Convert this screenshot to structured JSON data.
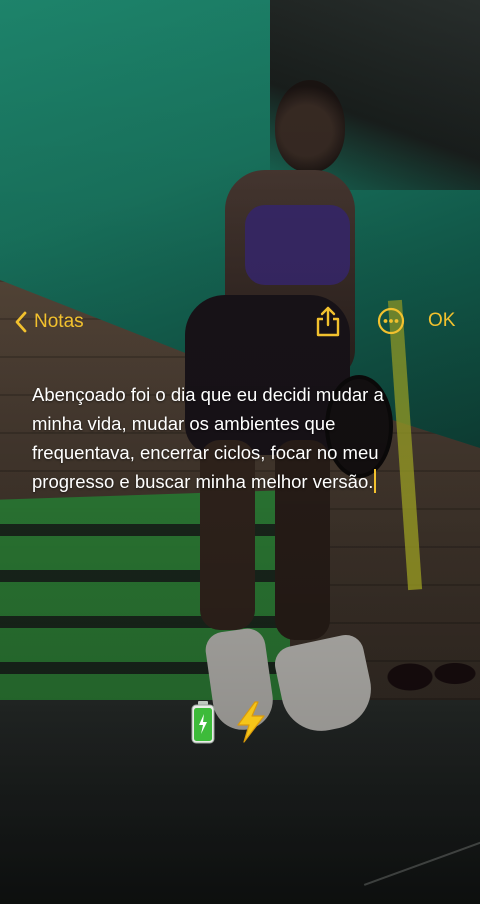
{
  "nav": {
    "back_label": "Notas",
    "done_label": "OK",
    "share_icon": "share-icon",
    "more_icon": "ellipsis-circle-icon"
  },
  "note": {
    "text": "Abençoado foi o dia que eu decidi mudar a minha vida, mudar os ambientes que frequentava, encerrar ciclos, focar no meu progresso e buscar minha melhor versão."
  },
  "emojis": [
    {
      "icon": "battery-full-icon"
    },
    {
      "icon": "lightning-icon"
    }
  ],
  "colors": {
    "accent": "#f2c12e",
    "text": "#ffffff"
  }
}
